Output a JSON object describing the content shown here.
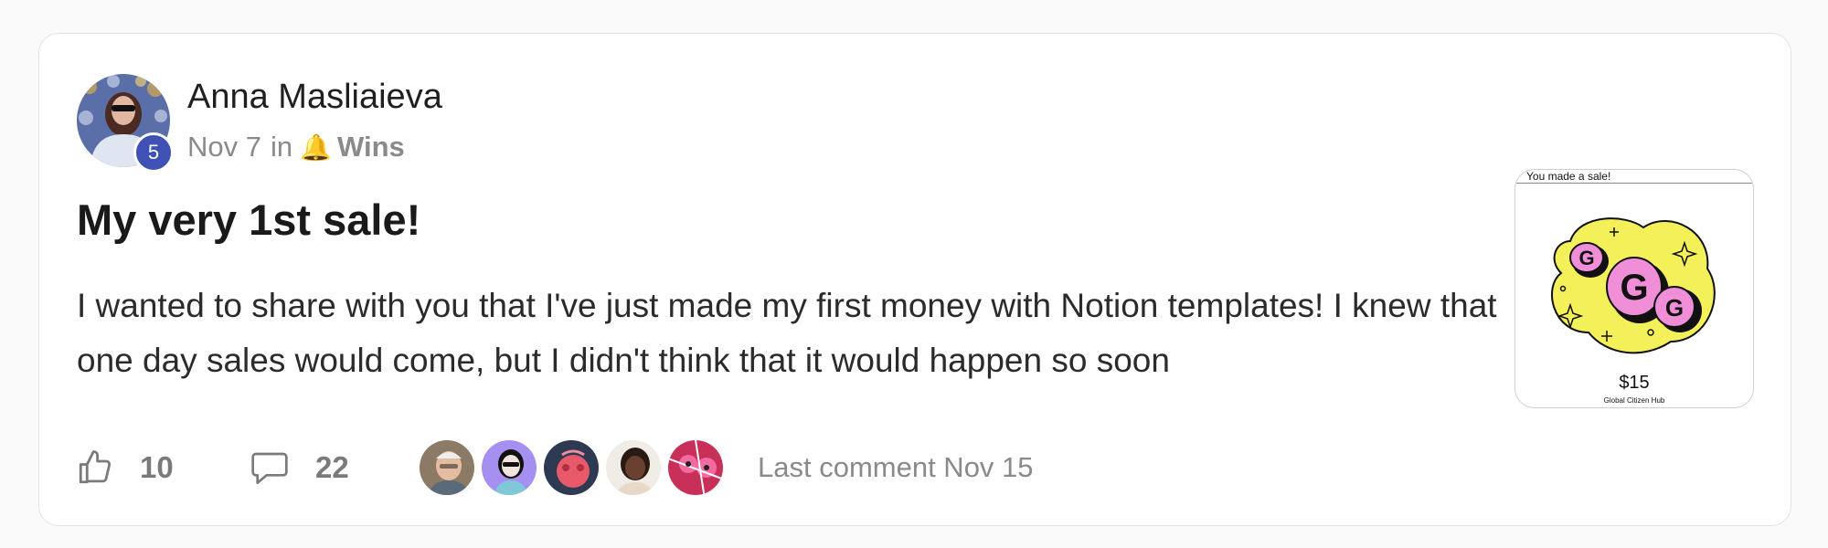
{
  "post": {
    "author": {
      "name": "Anna Masliaieva",
      "level": "5"
    },
    "date": "Nov 7",
    "in_label": "in",
    "category_icon": "bell-icon",
    "category": "Wins",
    "title": "My very 1st sale!",
    "body": "I wanted to share with you that I've just made my first money with Notion templates! I knew that one day sales would come, but I didn't think that it would happen so soon",
    "attachment": {
      "header": "You made a sale!",
      "price": "$15",
      "store": "Global Citizen Hub"
    }
  },
  "footer": {
    "likes": "10",
    "comments": "22",
    "last_comment": "Last comment Nov 15"
  },
  "colors": {
    "level_badge": "#3f51b5",
    "meta_text": "#8a8a8a",
    "title_text": "#1a1a1a"
  }
}
